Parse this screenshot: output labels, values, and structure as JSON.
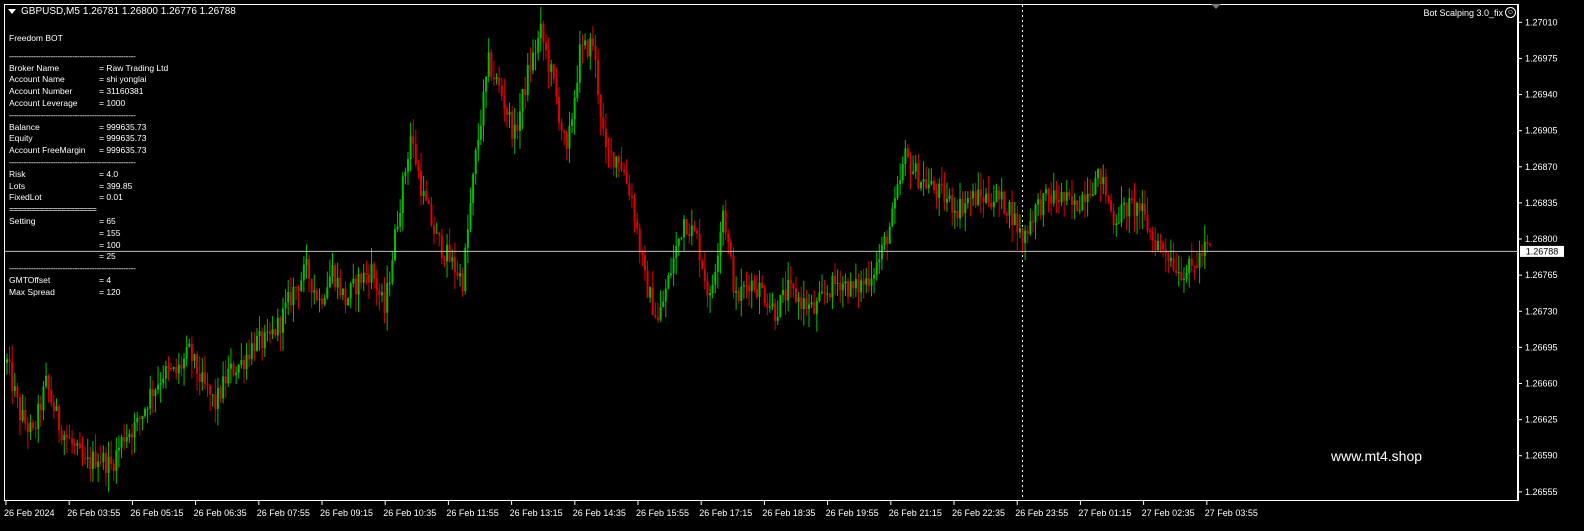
{
  "header": {
    "symbol": "GBPUSD,M5",
    "quote": "1.26781 1.26800 1.26776 1.26788"
  },
  "ea": {
    "label": "Bot Scalping 3.0_fix",
    "icon": "smiley-icon"
  },
  "panel": {
    "title": "Freedom BOT",
    "sep": "----------------------------------------------------",
    "sep_double": "====================",
    "broker": [
      {
        "key": "Broker Name",
        "value": "= Raw Trading Ltd"
      },
      {
        "key": "Account Name",
        "value": "= shi yonglai"
      },
      {
        "key": "Account Number",
        "value": "= 31160381"
      },
      {
        "key": "Account Leverage",
        "value": "= 1000"
      }
    ],
    "balance": [
      {
        "key": "Balance",
        "value": "= 999635.73"
      },
      {
        "key": "Equity",
        "value": "= 999635.73"
      },
      {
        "key": "Account FreeMargin",
        "value": "= 999635.73"
      }
    ],
    "risk": [
      {
        "key": "Risk",
        "value": "= 4.0"
      },
      {
        "key": "Lots",
        "value": "= 399.85"
      },
      {
        "key": "FixedLot",
        "value": "= 0.01"
      }
    ],
    "settings": [
      {
        "key": "Setting",
        "value": "= 65"
      },
      {
        "key": "",
        "value": "= 155"
      },
      {
        "key": "",
        "value": "= 100"
      },
      {
        "key": "",
        "value": "= 25"
      }
    ],
    "misc": [
      {
        "key": "GMTOffset",
        "value": "= 4"
      },
      {
        "key": "Max Spread",
        "value": "= 120"
      }
    ]
  },
  "watermark": "www.mt4.shop",
  "current_price_label": "1.26788",
  "colors": {
    "background": "#000000",
    "bull": "#00c000",
    "bear": "#e00000",
    "grid_line": "#c0c0c0",
    "axis": "#ffffff"
  },
  "chart_data": {
    "type": "candlestick",
    "symbol": "GBPUSD",
    "timeframe": "M5",
    "ylim": [
      1.2655,
      1.2702
    ],
    "price_ticks": [
      "1.27010",
      "1.26975",
      "1.26940",
      "1.26905",
      "1.26870",
      "1.26835",
      "1.26800",
      "1.26765",
      "1.26730",
      "1.26695",
      "1.26660",
      "1.26625",
      "1.26590",
      "1.26555"
    ],
    "time_ticks": [
      "26 Feb 2024",
      "26 Feb 03:55",
      "26 Feb 05:15",
      "26 Feb 06:35",
      "26 Feb 07:55",
      "26 Feb 09:15",
      "26 Feb 10:35",
      "26 Feb 11:55",
      "26 Feb 13:15",
      "26 Feb 14:35",
      "26 Feb 15:55",
      "26 Feb 17:15",
      "26 Feb 18:35",
      "26 Feb 19:55",
      "26 Feb 21:15",
      "26 Feb 22:35",
      "26 Feb 23:55",
      "27 Feb 01:15",
      "27 Feb 02:35",
      "27 Feb 03:55"
    ],
    "current_price": 1.26788,
    "close_path": [
      [
        0,
        1.2668
      ],
      [
        5,
        1.2663
      ],
      [
        10,
        1.2661
      ],
      [
        15,
        1.2666
      ],
      [
        20,
        1.2662
      ],
      [
        25,
        1.266
      ],
      [
        30,
        1.2658
      ],
      [
        35,
        1.2659
      ],
      [
        40,
        1.2658
      ],
      [
        45,
        1.2661
      ],
      [
        50,
        1.2662
      ],
      [
        55,
        1.2665
      ],
      [
        60,
        1.2667
      ],
      [
        65,
        1.2667
      ],
      [
        70,
        1.2669
      ],
      [
        75,
        1.2666
      ],
      [
        80,
        1.2664
      ],
      [
        85,
        1.2667
      ],
      [
        90,
        1.2668
      ],
      [
        95,
        1.267
      ],
      [
        100,
        1.267
      ],
      [
        105,
        1.2672
      ],
      [
        110,
        1.2675
      ],
      [
        115,
        1.2677
      ],
      [
        120,
        1.2674
      ],
      [
        125,
        1.2677
      ],
      [
        130,
        1.2674
      ],
      [
        135,
        1.2676
      ],
      [
        140,
        1.2677
      ],
      [
        145,
        1.2673
      ],
      [
        150,
        1.2682
      ],
      [
        155,
        1.269
      ],
      [
        160,
        1.2684
      ],
      [
        165,
        1.268
      ],
      [
        170,
        1.2678
      ],
      [
        175,
        1.2676
      ],
      [
        180,
        1.2688
      ],
      [
        185,
        1.2697
      ],
      [
        190,
        1.2694
      ],
      [
        195,
        1.269
      ],
      [
        200,
        1.2696
      ],
      [
        205,
        1.27
      ],
      [
        210,
        1.2695
      ],
      [
        215,
        1.2688
      ],
      [
        220,
        1.2698
      ],
      [
        225,
        1.2699
      ],
      [
        230,
        1.2688
      ],
      [
        235,
        1.2688
      ],
      [
        240,
        1.2684
      ],
      [
        245,
        1.2676
      ],
      [
        250,
        1.2672
      ],
      [
        255,
        1.2677
      ],
      [
        260,
        1.2682
      ],
      [
        265,
        1.268
      ],
      [
        270,
        1.2674
      ],
      [
        275,
        1.2683
      ],
      [
        280,
        1.2674
      ],
      [
        285,
        1.2676
      ],
      [
        290,
        1.2675
      ],
      [
        295,
        1.2673
      ],
      [
        300,
        1.2675
      ],
      [
        305,
        1.2674
      ],
      [
        310,
        1.2673
      ],
      [
        315,
        1.2675
      ],
      [
        320,
        1.2676
      ],
      [
        325,
        1.2675
      ],
      [
        330,
        1.2676
      ],
      [
        335,
        1.2678
      ],
      [
        340,
        1.2682
      ],
      [
        345,
        1.2688
      ],
      [
        350,
        1.2686
      ],
      [
        355,
        1.2685
      ],
      [
        360,
        1.2684
      ],
      [
        365,
        1.2683
      ],
      [
        370,
        1.2684
      ],
      [
        375,
        1.2684
      ],
      [
        380,
        1.2684
      ],
      [
        385,
        1.2683
      ],
      [
        390,
        1.268
      ],
      [
        395,
        1.2683
      ],
      [
        400,
        1.2684
      ],
      [
        405,
        1.2684
      ],
      [
        410,
        1.2683
      ],
      [
        415,
        1.2685
      ],
      [
        420,
        1.2686
      ],
      [
        425,
        1.2682
      ],
      [
        430,
        1.2683
      ],
      [
        435,
        1.2683
      ],
      [
        440,
        1.268
      ],
      [
        445,
        1.2679
      ],
      [
        450,
        1.2677
      ],
      [
        455,
        1.2677
      ],
      [
        460,
        1.2679
      ],
      [
        462,
        1.2679
      ]
    ]
  }
}
